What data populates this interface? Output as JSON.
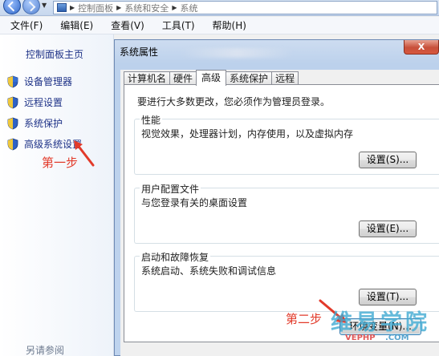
{
  "address_bar": {
    "crumbs": [
      "控制面板",
      "系统和安全",
      "系统"
    ]
  },
  "menu": {
    "items": [
      "文件(F)",
      "编辑(E)",
      "查看(V)",
      "工具(T)",
      "帮助(H)"
    ]
  },
  "left_pane": {
    "home_link": "控制面板主页",
    "links": [
      {
        "label": "设备管理器",
        "icon": "shield-icon"
      },
      {
        "label": "远程设置",
        "icon": "shield-icon"
      },
      {
        "label": "系统保护",
        "icon": "shield-icon"
      },
      {
        "label": "高级系统设置",
        "icon": "shield-icon"
      }
    ],
    "see_also": "另请参阅"
  },
  "annotations": {
    "step1": "第一步",
    "step2": "第二步",
    "color": "#e23a2a"
  },
  "dialog": {
    "title": "系统属性",
    "close_label": "X",
    "tabs": [
      {
        "label": "计算机名",
        "active": false
      },
      {
        "label": "硬件",
        "active": false
      },
      {
        "label": "高级",
        "active": true
      },
      {
        "label": "系统保护",
        "active": false
      },
      {
        "label": "远程",
        "active": false
      }
    ],
    "admin_note": "要进行大多数更改，您必须作为管理员登录。",
    "groups": [
      {
        "title": "性能",
        "desc": "视觉效果，处理器计划，内存使用，以及虚拟内存",
        "button": "设置(S)..."
      },
      {
        "title": "用户配置文件",
        "desc": "与您登录有关的桌面设置",
        "button": "设置(E)..."
      },
      {
        "title": "启动和故障恢复",
        "desc": "系统启动、系统失败和调试信息",
        "button": "设置(T)..."
      }
    ],
    "env_button": "环境变量(N)..."
  },
  "watermark": {
    "main": "维易学院",
    "sub_a": "VEPHP",
    "sub_b": ".COM"
  },
  "colors": {
    "link": "#1e3287",
    "dialog_frame": "#bcd1ec",
    "close": "#c7503a"
  }
}
